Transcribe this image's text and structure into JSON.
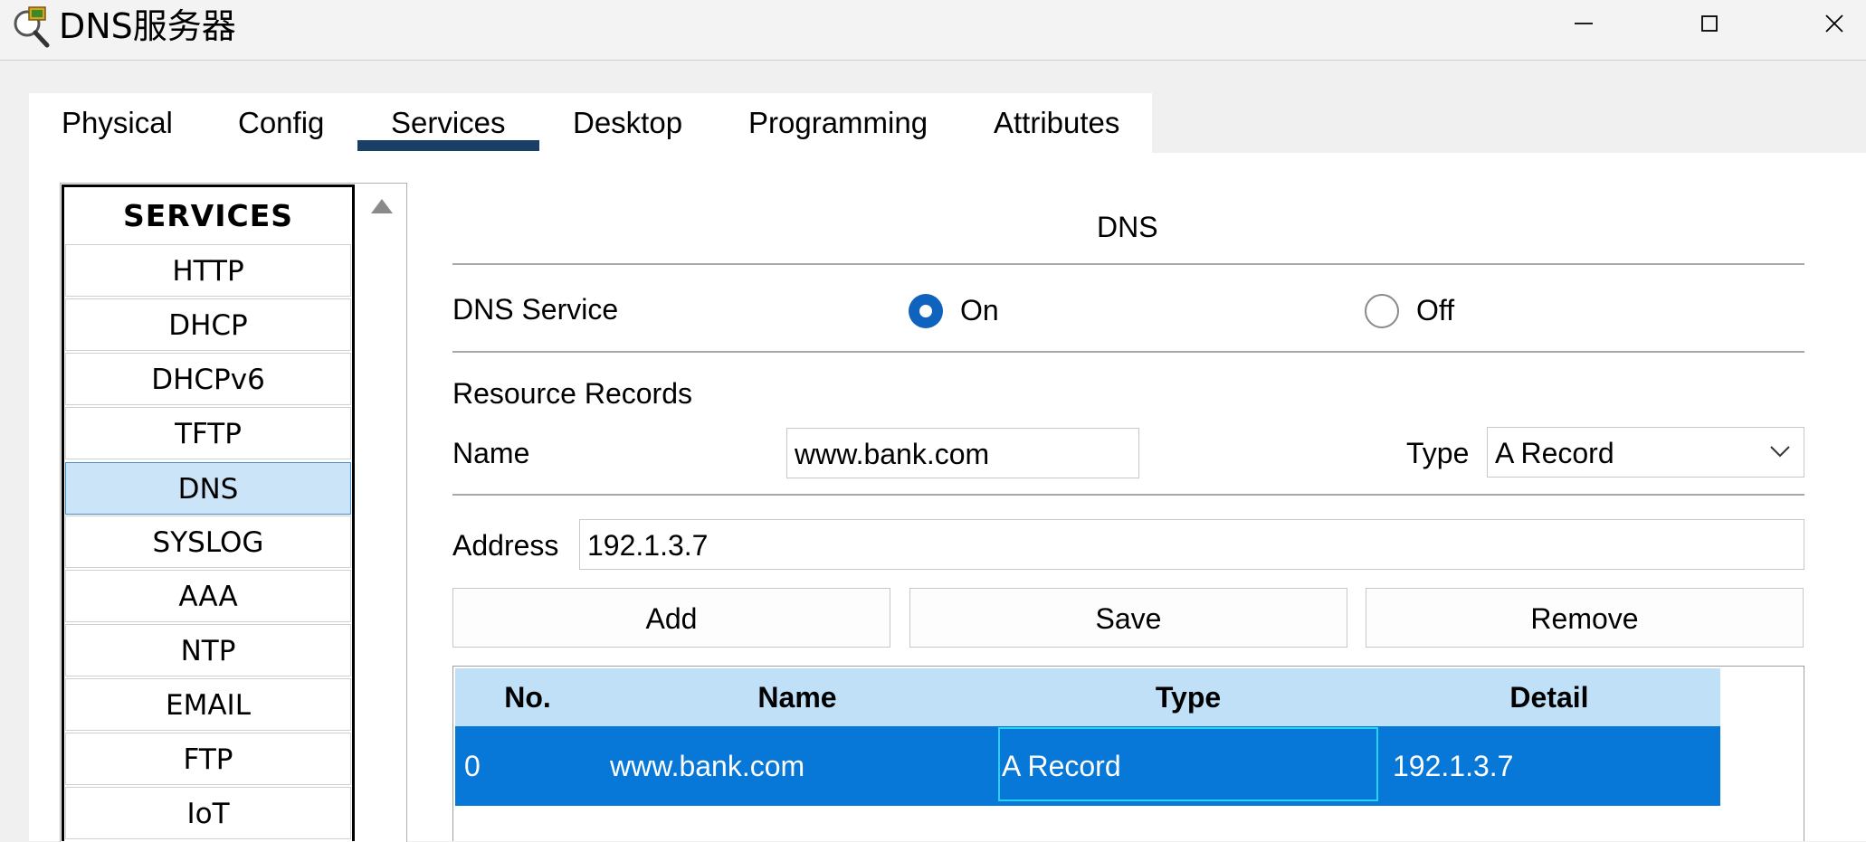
{
  "window": {
    "title": "DNS服务器",
    "icon": "dns-server-magnifier-icon",
    "controls": [
      "minimize-icon",
      "maximize-icon",
      "close-icon"
    ]
  },
  "tabs": [
    {
      "label": "Physical"
    },
    {
      "label": "Config"
    },
    {
      "label": "Services",
      "active": true
    },
    {
      "label": "Desktop"
    },
    {
      "label": "Programming"
    },
    {
      "label": "Attributes"
    }
  ],
  "services": {
    "header": "SERVICES",
    "items": [
      {
        "label": "HTTP"
      },
      {
        "label": "DHCP"
      },
      {
        "label": "DHCPv6"
      },
      {
        "label": "TFTP"
      },
      {
        "label": "DNS",
        "selected": true
      },
      {
        "label": "SYSLOG"
      },
      {
        "label": "AAA"
      },
      {
        "label": "NTP"
      },
      {
        "label": "EMAIL"
      },
      {
        "label": "FTP"
      },
      {
        "label": "IoT"
      }
    ]
  },
  "dns": {
    "section_title": "DNS",
    "service_label": "DNS Service",
    "on_label": "On",
    "off_label": "Off",
    "service_state": "On",
    "resource_records_label": "Resource Records",
    "name_label": "Name",
    "name_value": "www.bank.com",
    "type_label": "Type",
    "type_value": "A Record",
    "address_label": "Address",
    "address_value": "192.1.3.7",
    "buttons": {
      "add": "Add",
      "save": "Save",
      "remove": "Remove"
    },
    "table": {
      "headers": [
        "No.",
        "Name",
        "Type",
        "Detail"
      ],
      "rows": [
        {
          "no": "0",
          "name": "www.bank.com",
          "type": "A Record",
          "detail": "192.1.3.7"
        }
      ]
    }
  },
  "colors": {
    "accent": "#0f62be",
    "tab_underline": "#1a3f66",
    "selected_row": "#0878d8",
    "table_header": "#bfe0f6",
    "selected_service": "#cce4f7"
  }
}
